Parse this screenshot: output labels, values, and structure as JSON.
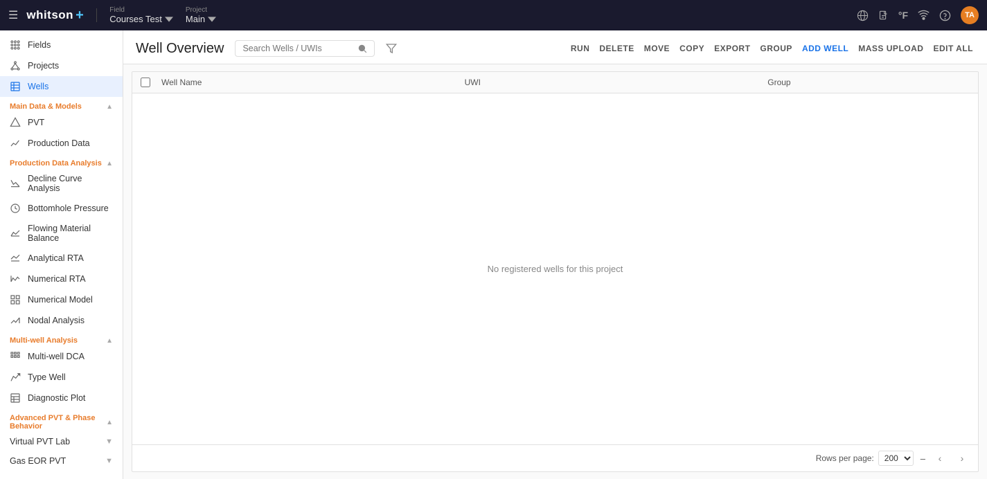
{
  "topbar": {
    "menu_icon": "☰",
    "logo": "whitson",
    "logo_plus": "+",
    "field_label": "Field",
    "field_value": "Courses Test",
    "project_label": "Project",
    "project_value": "Main",
    "icons": [
      "globe",
      "document",
      "temperature",
      "signal",
      "help"
    ],
    "avatar_initials": "TA"
  },
  "sidebar": {
    "top_items": [
      {
        "label": "Fields",
        "icon": "grid"
      },
      {
        "label": "Projects",
        "icon": "nodes"
      },
      {
        "label": "Wells",
        "icon": "table",
        "active": true
      }
    ],
    "sections": [
      {
        "title": "Main Data & Models",
        "collapsed": false,
        "items": [
          {
            "label": "PVT",
            "icon": "molecule"
          },
          {
            "label": "Production Data",
            "icon": "chart-line"
          }
        ]
      },
      {
        "title": "Production Data Analysis",
        "collapsed": false,
        "items": [
          {
            "label": "Decline Curve Analysis",
            "icon": "decline"
          },
          {
            "label": "Bottomhole Pressure",
            "icon": "gauge"
          },
          {
            "label": "Flowing Material Balance",
            "icon": "balance"
          },
          {
            "label": "Analytical RTA",
            "icon": "analytical"
          },
          {
            "label": "Numerical RTA",
            "icon": "numerical"
          },
          {
            "label": "Numerical Model",
            "icon": "model"
          },
          {
            "label": "Nodal Analysis",
            "icon": "nodal"
          }
        ]
      },
      {
        "title": "Multi-well Analysis",
        "collapsed": false,
        "items": [
          {
            "label": "Multi-well DCA",
            "icon": "multi-dca"
          },
          {
            "label": "Type Well",
            "icon": "type-well"
          },
          {
            "label": "Diagnostic Plot",
            "icon": "diagnostic"
          }
        ]
      },
      {
        "title": "Advanced PVT & Phase Behavior",
        "collapsed": false,
        "expandable": [
          {
            "label": "Virtual PVT Lab"
          },
          {
            "label": "Gas EOR PVT"
          }
        ]
      }
    ]
  },
  "page": {
    "title": "Well Overview",
    "search_placeholder": "Search Wells / UWIs",
    "actions": [
      "RUN",
      "DELETE",
      "MOVE",
      "COPY",
      "EXPORT",
      "GROUP",
      "ADD WELL",
      "MASS UPLOAD",
      "EDIT ALL"
    ],
    "table": {
      "columns": [
        "Well Name",
        "UWI",
        "Group"
      ],
      "empty_message": "No registered wells for this project",
      "rows_per_page_label": "Rows per page:",
      "rows_per_page_value": "200",
      "pagination_separator": "–"
    }
  }
}
